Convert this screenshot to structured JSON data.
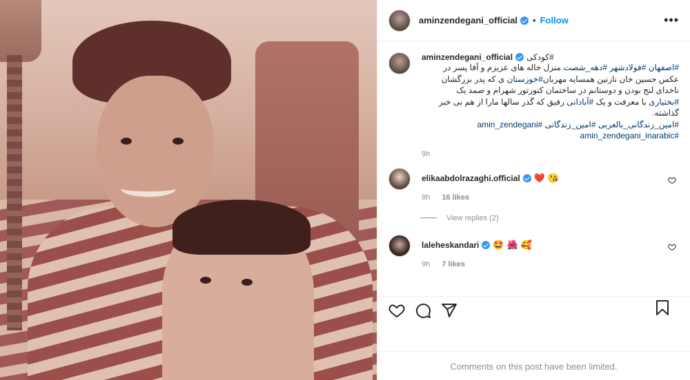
{
  "post": {
    "author": "aminzendegani_official",
    "follow_label": "Follow",
    "dot": "•",
    "more_label": "•••"
  },
  "caption": {
    "username": "aminzendegani_official",
    "line1_hash": "#کودکی",
    "line2_hash1": "#اصفهان",
    "line2_hash2": "#فولادشهر",
    "line2_hash3": "#دهه_شصت",
    "line2_text": "منزل خاله های عزیزم و آقا پسر در",
    "line3a": "عکس حسین خان نازنین همسایه مهربان",
    "line3_hash": "#خوزستان",
    "line3b": "ی که پدر بزرگشان",
    "line4": "ناخدای لنج بودن و دوستانم در ساختمان کنورتور شهرام و صمد یک",
    "line5_hash1": "#بختیاری",
    "line5a": "با معرفت و یک",
    "line5_hash2": "#آبادانی",
    "line5b": "رفیق که گذر سالها مارا از هم بی خبر",
    "line6": "گذاشته.",
    "tag1": "#امین_زندگانی_بالعربی",
    "tag2": "#امین_زندگانی",
    "tag3": "#amin_zendegani",
    "tag4": "#amin_zendegani_inarabic",
    "time": "9h"
  },
  "comments": [
    {
      "username": "elikaabdolrazaghi.official",
      "emojis": [
        "❤️",
        "😘"
      ],
      "time": "9h",
      "likes": "16 likes",
      "view_replies": "View replies (2)"
    },
    {
      "username": "laleheskandari",
      "emojis": [
        "🤩",
        "🌺",
        "🥰"
      ],
      "time": "9h",
      "likes": "7 likes"
    }
  ],
  "footer": {
    "limited_text": "Comments on this post have been limited."
  },
  "icons": {
    "like": "heart-icon",
    "comment": "comment-icon",
    "share": "share-icon",
    "save": "bookmark-icon"
  }
}
